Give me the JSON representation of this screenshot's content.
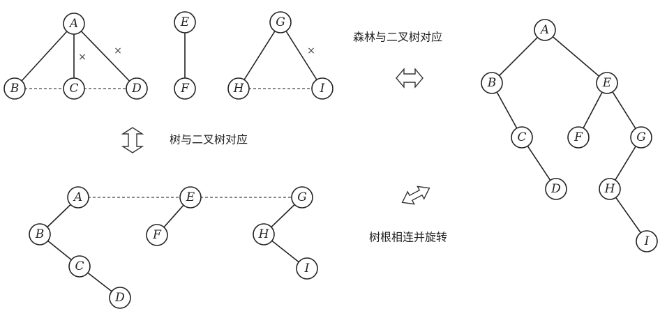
{
  "labels": {
    "forest_to_binary": "森林与二叉树对应",
    "tree_to_binary": "树与二叉树对应",
    "connect_and_rotate": "树根相连并旋转"
  },
  "nodes": {
    "A": "A",
    "B": "B",
    "C": "C",
    "D": "D",
    "E": "E",
    "F": "F",
    "G": "G",
    "H": "H",
    "I": "I"
  },
  "cross_mark": "×"
}
